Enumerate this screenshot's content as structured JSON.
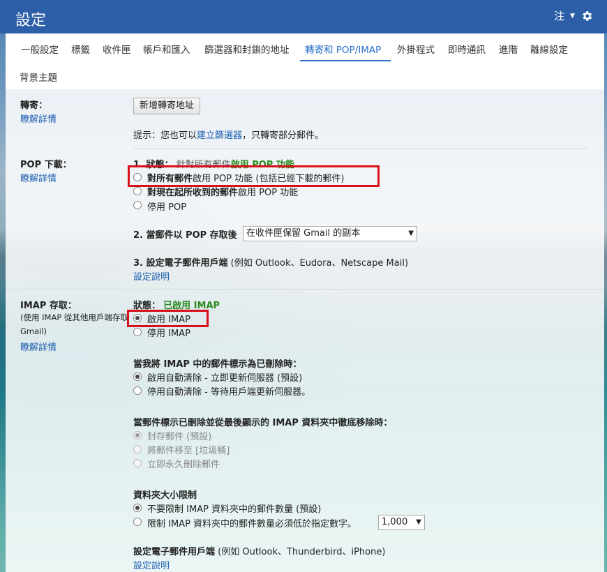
{
  "header": {
    "title": "設定",
    "account": "注"
  },
  "tabs": [
    "一般設定",
    "標籤",
    "收件匣",
    "帳戶和匯入",
    "篩選器和封鎖的地址",
    "轉寄和 POP/IMAP",
    "外掛程式",
    "即時通訊",
    "進階",
    "離線設定"
  ],
  "tab_row2": "背景主題",
  "forward": {
    "label": "轉寄：",
    "learn_more": "瞭解詳情",
    "button": "新增轉寄地址",
    "hint_prefix": "提示：您也可以",
    "hint_link": "建立篩選器",
    "hint_suffix": "，只轉寄部分郵件。"
  },
  "pop": {
    "label": "POP 下載：",
    "learn_more": "瞭解詳情",
    "status_prefix": "1. 狀態：",
    "status_value": "針對所有郵件啟用 POP 功能",
    "status_green": "啟用 POP 功能",
    "opt1_bold": "對所有郵件",
    "opt1_rest": "啟用 POP 功能 (包括已經下載的郵件)",
    "opt2_bold": "對現在起所收到的郵件",
    "opt2_rest": "啟用 POP 功能",
    "opt3": "停用 POP",
    "access_label": "2. 當郵件以 POP 存取後",
    "access_select": "在收件匣保留 Gmail 的副本",
    "client_label": "3. 設定電子郵件用戶端",
    "client_note": "(例如 Outlook、Eudora、Netscape Mail)",
    "setup_link": "設定說明"
  },
  "imap": {
    "label": "IMAP 存取：",
    "desc": "(使用 IMAP 從其他用戶端存取 Gmail)",
    "learn_more": "瞭解詳情",
    "status_prefix": "狀態：",
    "status_value": "已啟用 IMAP",
    "enable": "啟用 IMAP",
    "disable": "停用 IMAP",
    "delete_heading": "當我將 IMAP 中的郵件標示為已刪除時：",
    "auto_on": "啟用自動清除 - 立即更新伺服器 (預設)",
    "auto_off": "停用自動清除 - 等待用戶端更新伺服器。",
    "expunge_heading": "當郵件標示已刪除並從最後顯示的 IMAP 資料夾中徹底移除時：",
    "archive": "封存郵件 (預設)",
    "trash": "將郵件移至 [垃圾桶]",
    "delete_forever": "立即永久刪除郵件",
    "folder_heading": "資料夾大小限制",
    "no_limit": "不要限制 IMAP 資料夾中的郵件數量 (預設)",
    "limit": "限制 IMAP 資料夾中的郵件數量必須低於指定數字。",
    "limit_value": "1,000",
    "client_label": "設定電子郵件用戶端",
    "client_note": "(例如 Outlook、Thunderbird、iPhone)",
    "setup_link": "設定說明"
  }
}
